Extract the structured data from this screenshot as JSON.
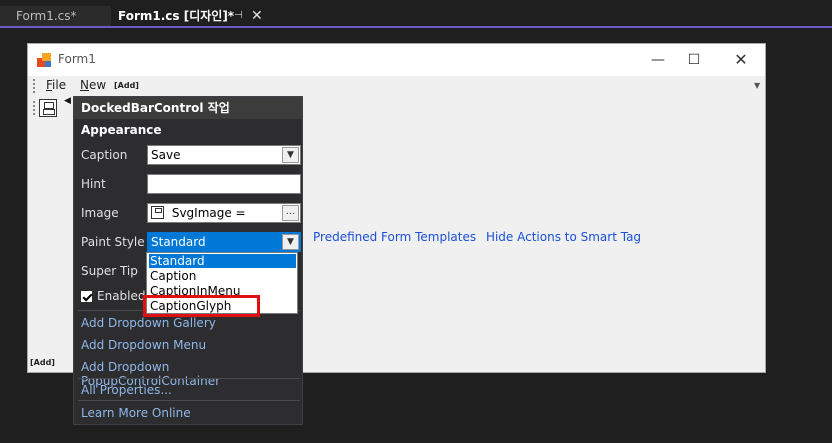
{
  "tabs": [
    {
      "label": "Form1.cs*",
      "active": false
    },
    {
      "label": "Form1.cs [디자인]*",
      "active": true
    }
  ],
  "form": {
    "title": "Form1",
    "menu": {
      "file": "File",
      "new": "New",
      "add": "[Add]"
    },
    "bottom_add": "[Add]",
    "links": [
      "Predefined Form Templates",
      "Hide Actions to Smart Tag"
    ]
  },
  "smart_panel": {
    "title": "DockedBarControl 작업",
    "section": "Appearance",
    "caption_label": "Caption",
    "caption_value": "Save",
    "hint_label": "Hint",
    "hint_value": "",
    "image_label": "Image",
    "image_value": "SvgImage =",
    "paint_style_label": "Paint Style",
    "paint_style_value": "Standard",
    "super_tip_label": "Super Tip",
    "enabled_label": "Enabled",
    "enabled_checked": true,
    "links": [
      "Add Dropdown Gallery",
      "Add Dropdown Menu",
      "Add Dropdown PopupControlContainer"
    ],
    "all_properties": "All Properties...",
    "learn_more": "Learn More Online"
  },
  "dropdown": {
    "options": [
      "Standard",
      "Caption",
      "CaptionInMenu",
      "CaptionGlyph"
    ],
    "selected": "Standard"
  },
  "colors": {
    "accent": "#0078d7",
    "highlight": "#e01010",
    "tab_underline": "#6a5acd",
    "link": "#1a4fd6"
  }
}
